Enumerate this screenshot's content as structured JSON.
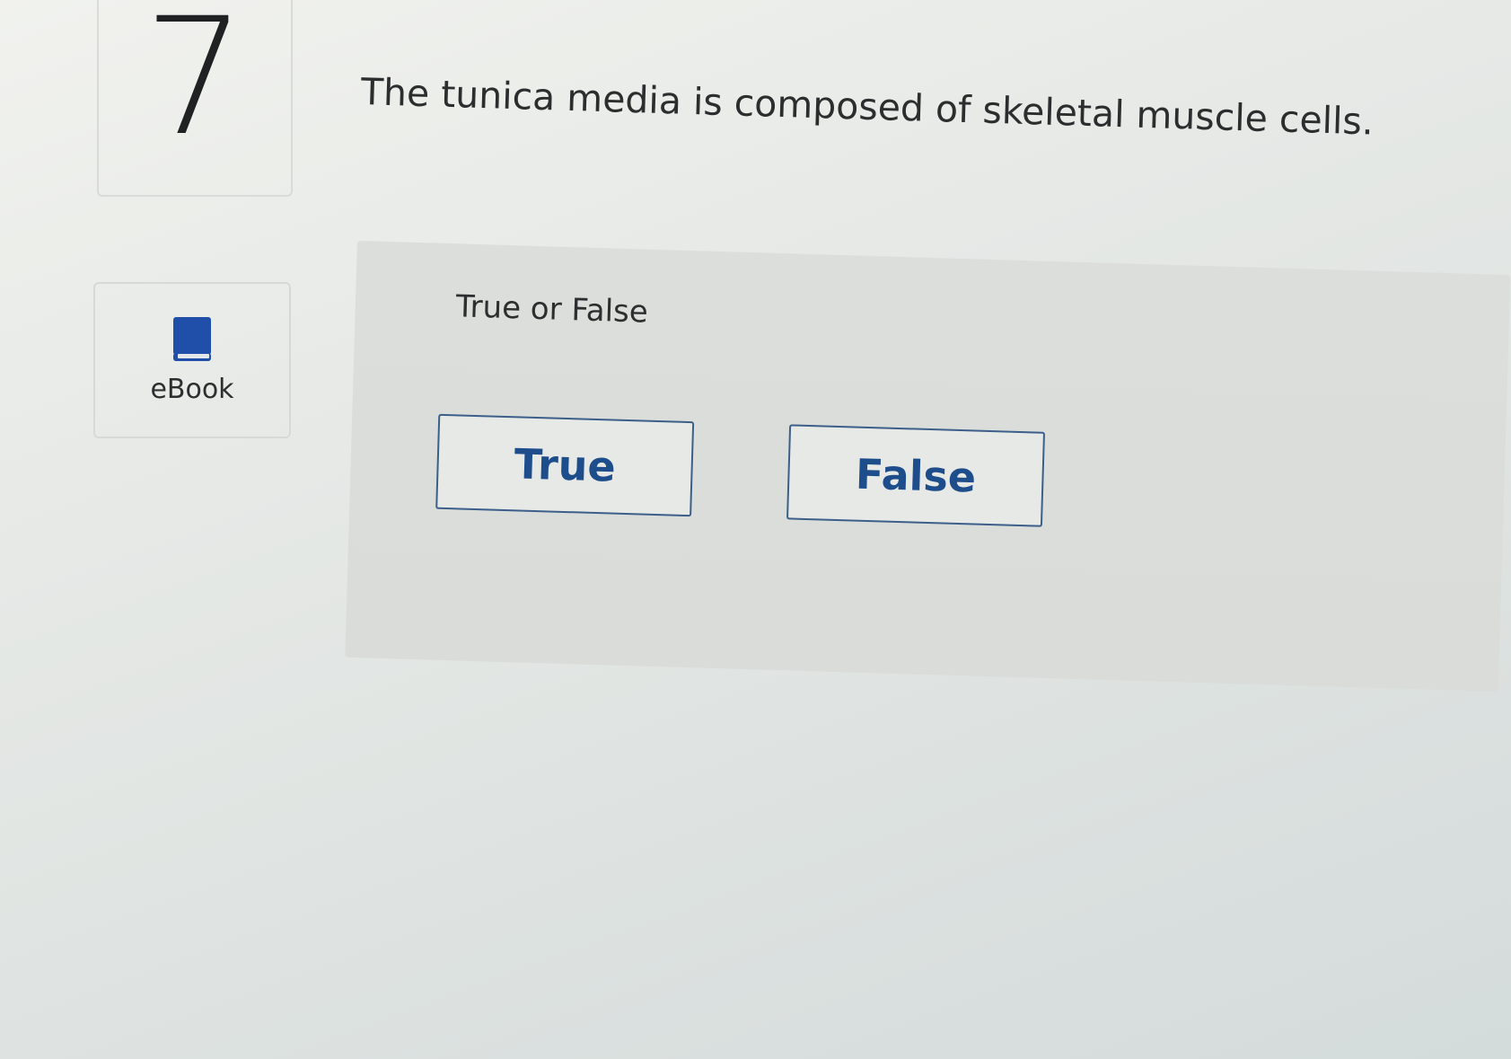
{
  "question": {
    "number": "7",
    "text": "The tunica media is composed of skeletal muscle cells."
  },
  "sidebar": {
    "ebook": {
      "label": "eBook",
      "icon": "book-icon"
    }
  },
  "answer": {
    "type_label": "True or False",
    "options": [
      {
        "label": "True"
      },
      {
        "label": "False"
      }
    ]
  },
  "colors": {
    "button_text": "#1e4d8c",
    "button_border": "#3b5f8a",
    "book_icon": "#1f4fa8"
  }
}
